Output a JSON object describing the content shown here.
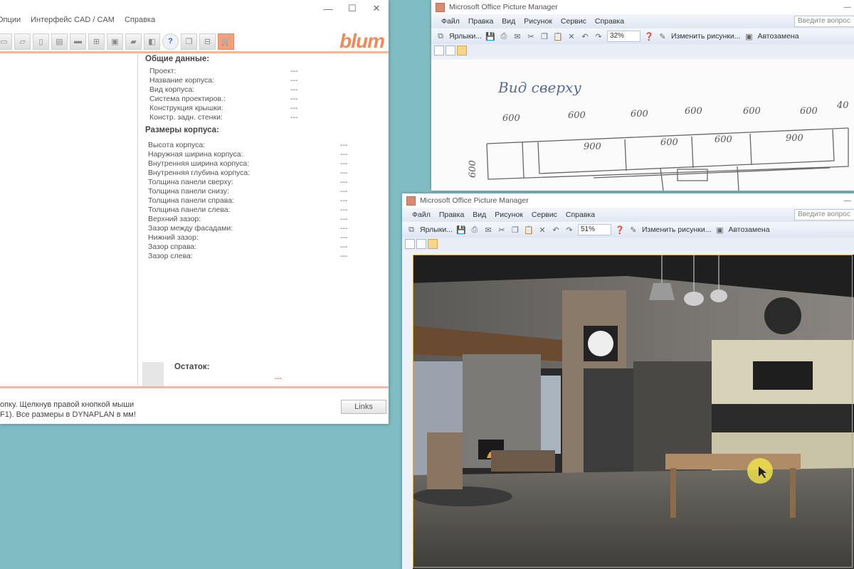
{
  "blum": {
    "menu": [
      "Опции",
      "Интерфейс CAD / CAM",
      "Справка"
    ],
    "logo": "blum",
    "general_title": "Общие данные:",
    "general_rows": [
      {
        "label": "Проект:",
        "value": "---"
      },
      {
        "label": "Название корпуса:",
        "value": "---"
      },
      {
        "label": "Вид корпуса:",
        "value": "---"
      },
      {
        "label": "Система проектиров.:",
        "value": "---"
      },
      {
        "label": "Конструкция крышки:",
        "value": "---"
      },
      {
        "label": "Констр. задн. стенки:",
        "value": "---"
      }
    ],
    "dims_title": "Размеры корпуса:",
    "dims_rows": [
      {
        "label": "Высота корпуса:",
        "value": "---"
      },
      {
        "label": "Наружная ширина корпуса:",
        "value": "---"
      },
      {
        "label": "Внутренняя ширина корпуса:",
        "value": "---"
      },
      {
        "label": "Внутренняя глубина корпуса:",
        "value": "---"
      },
      {
        "label": "Толщина панели сверху:",
        "value": "---"
      },
      {
        "label": "Толщина панели снизу:",
        "value": "---"
      },
      {
        "label": "Толщина панели справа:",
        "value": "---"
      },
      {
        "label": "Толщина панели слева:",
        "value": "---"
      },
      {
        "label": "Верхний зазор:",
        "value": "---"
      },
      {
        "label": "Зазор между фасадами:",
        "value": "---"
      },
      {
        "label": "Нижний зазор:",
        "value": "---"
      },
      {
        "label": "Зазор справа:",
        "value": "---"
      },
      {
        "label": "Зазор слева:",
        "value": "---"
      }
    ],
    "rest_label": "Остаток:",
    "rest_value": "---",
    "status_line1": "опку. Щелкнув правой кнопкой мыши",
    "status_line2": "F1). Все размеры в DYNAPLAN в мм!",
    "links_button": "Links"
  },
  "pm_top": {
    "title": "Microsoft Office Picture Manager",
    "menu": [
      "Файл",
      "Правка",
      "Вид",
      "Рисунок",
      "Сервис",
      "Справка"
    ],
    "ask": "Введите вопрос",
    "shortcuts": "Ярлыки...",
    "zoom": "32%",
    "edit_pictures": "Изменить рисунки...",
    "autocorrect": "Автозамена",
    "sketch": {
      "caption": "Вид сверху",
      "top_dims": [
        "600",
        "600",
        "600",
        "600",
        "600",
        "600",
        "40"
      ],
      "inner_dims": [
        "900",
        "600",
        "600",
        "900"
      ],
      "side_dim": "600"
    }
  },
  "pm_bottom": {
    "title": "Microsoft Office Picture Manager",
    "menu": [
      "Файл",
      "Правка",
      "Вид",
      "Рисунок",
      "Сервис",
      "Справка"
    ],
    "ask": "Введите вопрос",
    "shortcuts": "Ярлыки...",
    "zoom": "51%",
    "edit_pictures": "Изменить рисунки...",
    "autocorrect": "Автозамена"
  },
  "colors": {
    "desktop": "#7fbcc3",
    "blum_orange": "#f08a5d",
    "pm_frame": "#eef2f8"
  }
}
